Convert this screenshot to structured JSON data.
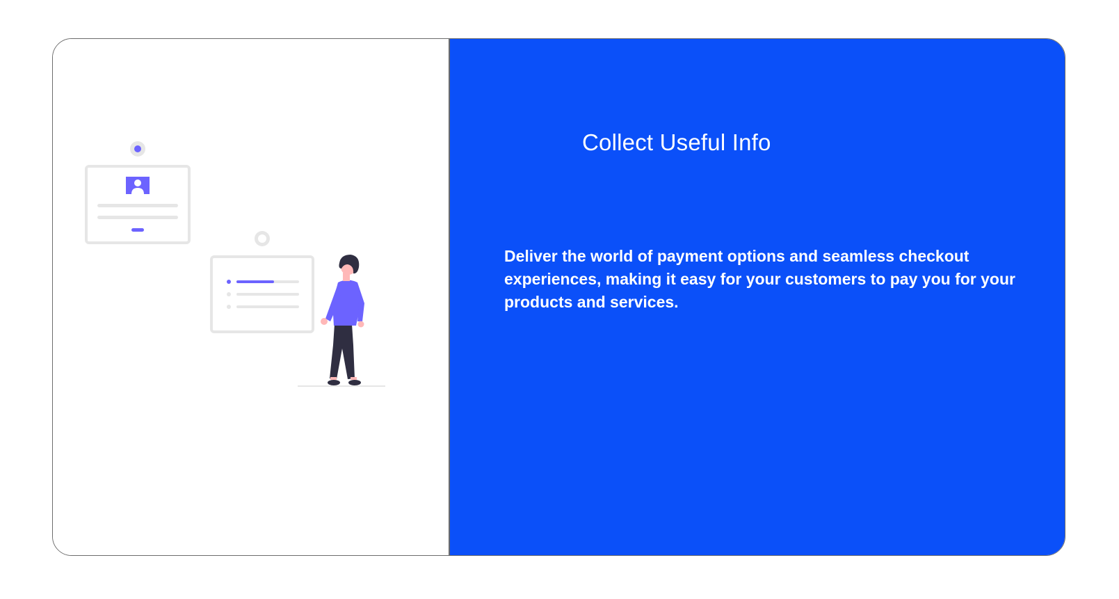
{
  "feature": {
    "title": "Collect Useful Info",
    "description": "Deliver the world of payment options and seamless checkout experiences, making it easy for your customers to pay you for your products and services."
  },
  "colors": {
    "panel_background": "#0b50f9",
    "accent_purple": "#6c63ff",
    "card_gray": "#e6e6e6",
    "text": "#ffffff"
  },
  "illustration": {
    "subject": "person-viewing-info-cards-illustration"
  }
}
